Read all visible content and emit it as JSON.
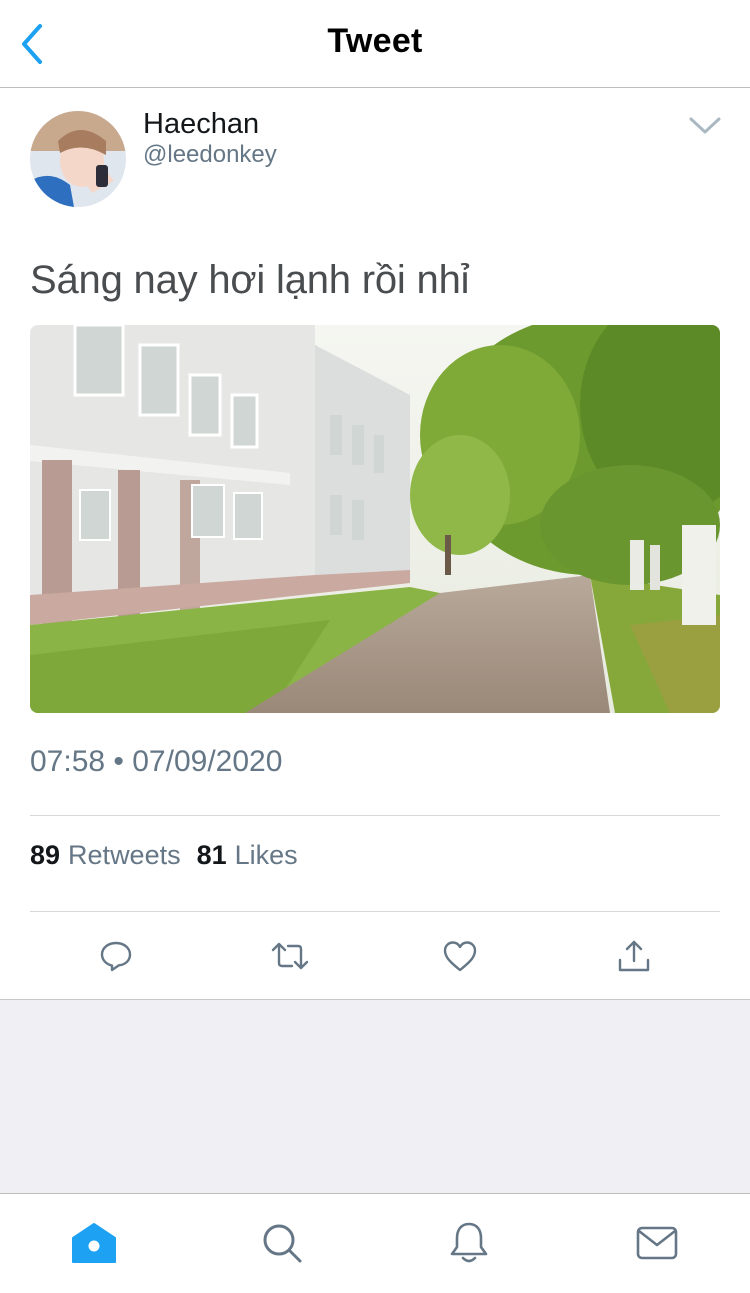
{
  "nav": {
    "title": "Tweet"
  },
  "tweet": {
    "author_name": "Haechan",
    "author_handle": "@leedonkey",
    "text": "Sáng nay hơi lạnh rồi nhỉ",
    "time": "07:58 • 07/09/2020",
    "retweet_count": "89",
    "retweet_label": "Retweets",
    "like_count": "81",
    "like_label": "Likes"
  },
  "icons": {
    "back": "chevron-left-icon",
    "caret": "chevron-down-icon",
    "reply": "reply-icon",
    "retweet": "retweet-icon",
    "like": "heart-icon",
    "share": "share-icon",
    "home": "home-icon",
    "search": "search-icon",
    "notifications": "bell-icon",
    "messages": "mail-icon"
  },
  "colors": {
    "accent": "#1da1f2",
    "icon_gray": "#657786",
    "text_dark": "#14171a",
    "background_gray": "#efeff4"
  }
}
